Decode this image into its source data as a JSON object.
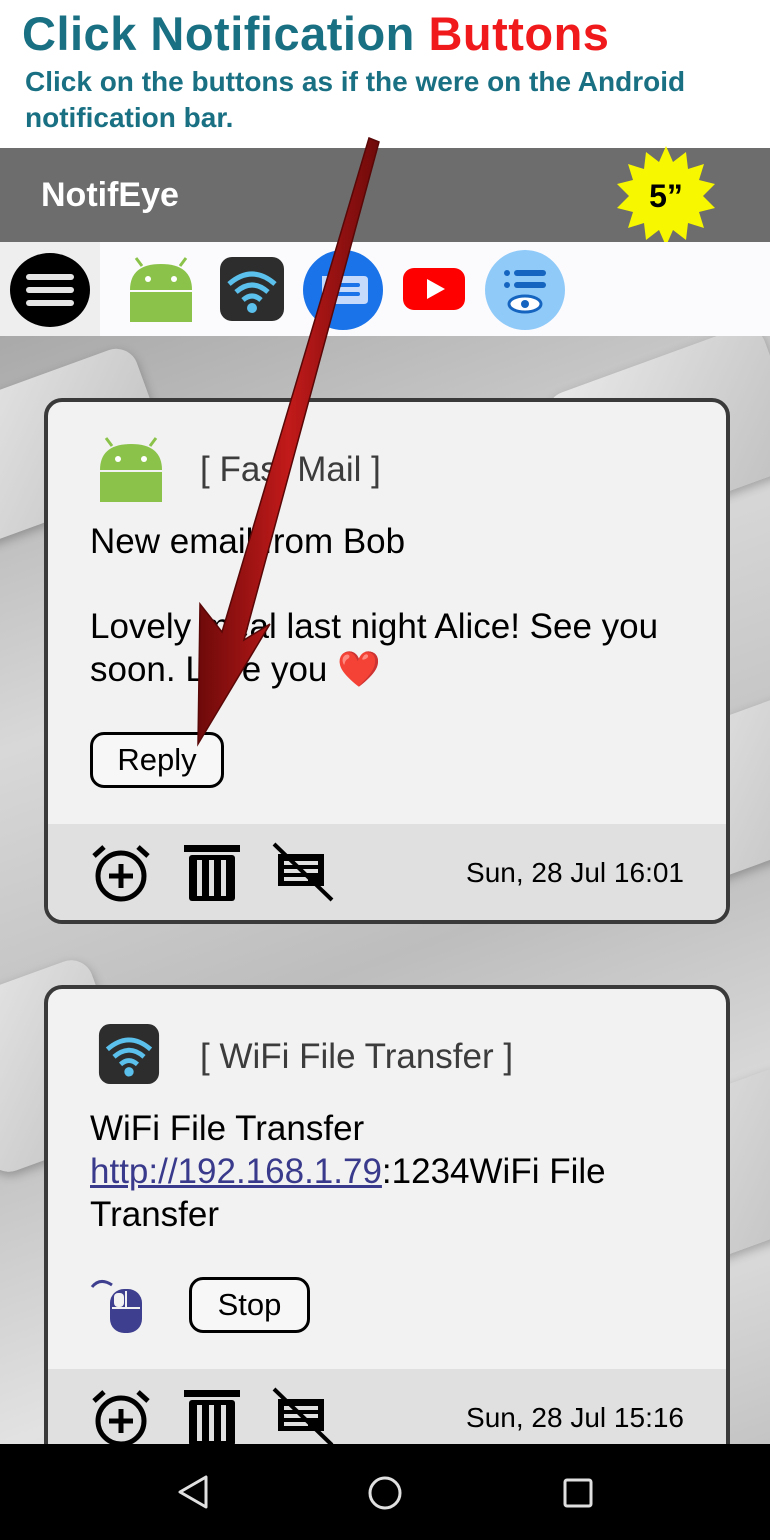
{
  "promo": {
    "title_part1": "Click Notification ",
    "title_part2": "Buttons",
    "subtitle": "Click on the buttons as if the were on the Android notification bar."
  },
  "app": {
    "title": "NotifEye",
    "badge": "5”"
  },
  "filter_bar": {
    "icons": [
      "menu-icon",
      "android-icon",
      "wifi-icon",
      "messages-icon",
      "youtube-icon",
      "notifeye-icon"
    ]
  },
  "notifications": [
    {
      "app_name": "[ Fast Mail ]",
      "icon": "android-icon",
      "title": "New email from Bob",
      "message": "Lovely meal last night Alice! See you soon. Love you",
      "emoji": "❤️",
      "actions": [
        "Reply"
      ],
      "timestamp": "Sun, 28 Jul 16:01"
    },
    {
      "app_name": "[ WiFi File Transfer ]",
      "icon": "wifi-icon",
      "title": "WiFi File Transfer",
      "link": "http://192.168.1.79",
      "message_rest": ":1234WiFi File Transfer",
      "actions": [
        "Stop"
      ],
      "timestamp": "Sun, 28 Jul 15:16"
    }
  ],
  "colors": {
    "promo_teal": "#1a7083",
    "promo_red": "#f0191c",
    "app_bar": "#6d6d6d",
    "badge_yellow": "#f7f700",
    "arrow": "#9b0f0f"
  }
}
